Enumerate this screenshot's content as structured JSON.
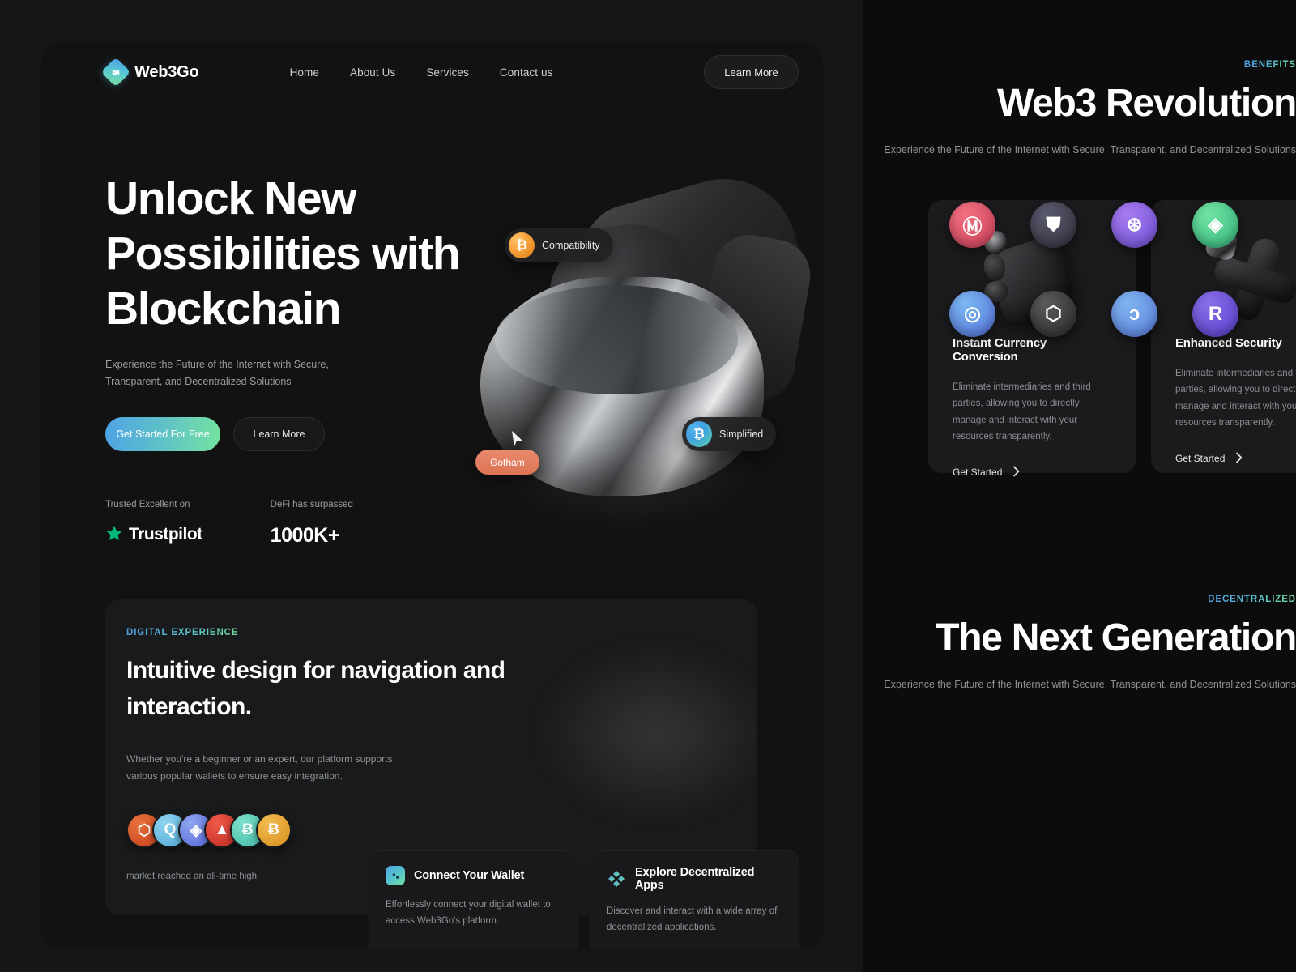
{
  "brand": {
    "name": "Web3Go",
    "logo_icon": "web3go-knot-diamond-icon"
  },
  "nav": {
    "links": [
      "Home",
      "About Us",
      "Services",
      "Contact us"
    ],
    "cta_label": "Learn More"
  },
  "hero": {
    "title_lines": [
      "Unlock New",
      "Possibilities with",
      "Blockchain"
    ],
    "subtitle": "Experience the Future of the Internet with Secure, Transparent, and Decentralized Solutions",
    "primary_cta": "Get Started For Free",
    "secondary_cta": "Learn More",
    "trust": {
      "label": "Trusted Excellent on",
      "provider": "Trustpilot",
      "star_color": "#00b67a"
    },
    "defi": {
      "label": "DeFi has surpassed",
      "value": "1000K+"
    },
    "badges": [
      {
        "label": "Compatibility",
        "icon": "bitcoin-icon",
        "icon_glyph": "Ƀ",
        "color": "#f0a63a"
      },
      {
        "label": "Simplified",
        "icon": "simplified-icon",
        "icon_glyph": "Ƀ",
        "color": "#4fb3e8"
      },
      {
        "label": "Gotham",
        "icon": "none",
        "color": "#e07d5d"
      }
    ]
  },
  "digital_experience": {
    "eyebrow": "DIGITAL EXPERIENCE",
    "title": "Intuitive design for navigation and interaction.",
    "body": "Whether you're a beginner or an expert, our platform supports various popular wallets to ensure easy integration.",
    "market_note": "market reached an all-time high",
    "avatars": [
      {
        "name": "cube-token-avatar",
        "glyph": "⬡",
        "color1": "#e8703a",
        "color2": "#c6421f"
      },
      {
        "name": "lightblue-token-avatar",
        "glyph": "Q",
        "color1": "#8fd4ef",
        "color2": "#4fa8d8"
      },
      {
        "name": "blue-token-avatar",
        "glyph": "◈",
        "color1": "#8fa6f0",
        "color2": "#5566d8"
      },
      {
        "name": "avalanche-avatar",
        "glyph": "▲",
        "color1": "#ef5a4a",
        "color2": "#c02a22"
      },
      {
        "name": "teal-token-avatar",
        "glyph": "Ƀ",
        "color1": "#7fe0cd",
        "color2": "#3fb9a6"
      },
      {
        "name": "bitcoin-avatar",
        "glyph": "Ƀ",
        "color1": "#f3bb52",
        "color2": "#d68f1b"
      }
    ]
  },
  "feature_cards": [
    {
      "title": "Connect Your Wallet",
      "body": "Effortlessly connect your digital wallet to access Web3Go's platform.",
      "icon": "wallet-gradient-icon"
    },
    {
      "title": "Explore Decentralized Apps",
      "body": "Discover and interact with a wide array of decentralized applications.",
      "icon": "dapps-diamond-icon"
    }
  ],
  "benefits_section": {
    "eyebrow": "BENEFITS",
    "title": "Web3 Revolution",
    "subtitle": "Experience the Future of the Internet with Secure, Transparent, and Decentralized Solutions",
    "cards": [
      {
        "title": "Instant Currency Conversion",
        "body": "Eliminate intermediaries and third parties, allowing you to directly manage and interact with your resources transparently.",
        "link_label": "Get Started",
        "art": "rounded-cube-3d"
      },
      {
        "title": "Enhanced Security",
        "body": "Eliminate intermediaries and third parties, allowing you to directly manage and interact with your resources transparently.",
        "link_label": "Get Started",
        "art": "cross-shape-3d"
      }
    ]
  },
  "next_generation_section": {
    "eyebrow": "DECENTRALIZED",
    "title": "The Next Generation",
    "subtitle": "Experience the Future of the Internet with Secure, Transparent, and Decentralized Solutions",
    "logos": [
      {
        "name": "monero-logo",
        "glyph": "Ⓜ",
        "color1": "#f07080",
        "color2": "#d0415b"
      },
      {
        "name": "shield-logo",
        "glyph": "⛊",
        "color1": "#5a5a6e",
        "color2": "#32323f"
      },
      {
        "name": "swirl-logo",
        "glyph": "⊛",
        "color1": "#a87bf0",
        "color2": "#6f52d8"
      },
      {
        "name": "diamond-logo",
        "glyph": "◈",
        "color1": "#72e3a4",
        "color2": "#35b97c"
      },
      {
        "name": "node-logo",
        "glyph": "◎",
        "color1": "#7ab8f0",
        "color2": "#5570dd"
      },
      {
        "name": "cube-logo",
        "glyph": "⬡",
        "color1": "#5a5a5c",
        "color2": "#2b2b2d"
      },
      {
        "name": "dragon-logo",
        "glyph": "ɔ",
        "color1": "#7fb4ef",
        "color2": "#5b7fe0"
      },
      {
        "name": "render-logo",
        "glyph": "R",
        "color1": "#8a6fe8",
        "color2": "#5a3fcf"
      }
    ]
  },
  "theme": {
    "page_bg": "#0b0b0c",
    "panel_left_bg": "#161617",
    "panel_right_bg": "#0c0c0d",
    "card_bg": "#121213",
    "accent_start": "#4ea3e6",
    "accent_end": "#74e3a0",
    "text_primary": "#ffffff",
    "text_muted": "#8f9295"
  }
}
